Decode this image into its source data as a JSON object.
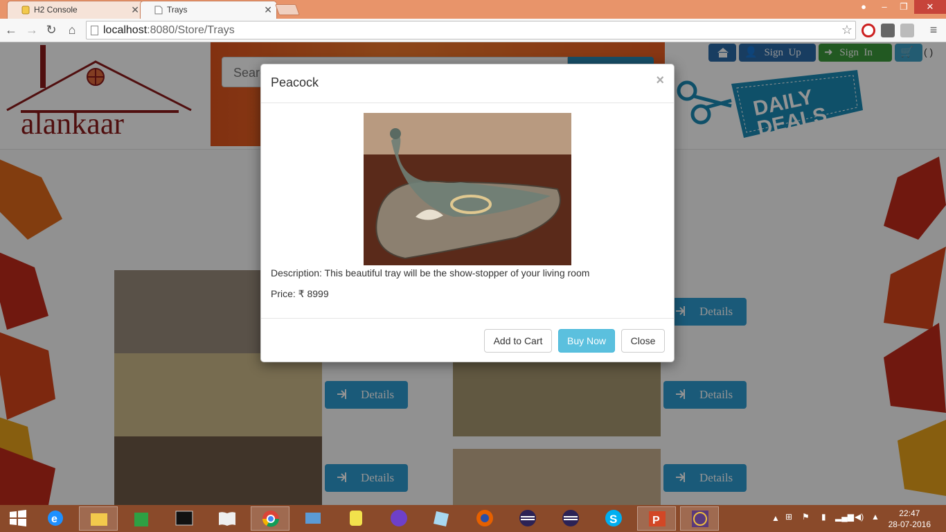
{
  "browser": {
    "tabs": [
      {
        "title": "H2 Console",
        "active": false
      },
      {
        "title": "Trays",
        "active": true
      }
    ],
    "url_host": "localhost",
    "url_path": ":8080/Store/Trays"
  },
  "site": {
    "logo_text": "alankaar",
    "search_placeholder": "Search",
    "nav": [
      {
        "label": "",
        "icon": "home-icon",
        "color": "#2a6aa8"
      },
      {
        "label": "Sign  Up",
        "icon": "user-icon",
        "color": "#2a6aa8"
      },
      {
        "label": "Sign  In",
        "icon": "sign-in-icon",
        "color": "#3c9a3c"
      },
      {
        "label": "",
        "icon": "cart-icon",
        "color": "#3d9fc4"
      }
    ],
    "cart_count": "( )",
    "deals_line1": "DAILY",
    "deals_line2": "DEALS",
    "details_label": "Details",
    "accent_color": "#2d9bd0"
  },
  "modal": {
    "title": "Peacock",
    "close_glyph": "×",
    "description": "Description: This beautiful tray will be the show-stopper of your living room",
    "price": "Price: ₹ 8999",
    "add_to_cart": "Add to Cart",
    "buy_now": "Buy Now",
    "close": "Close"
  },
  "taskbar": {
    "time": "22:47",
    "date": "28-07-2016"
  }
}
